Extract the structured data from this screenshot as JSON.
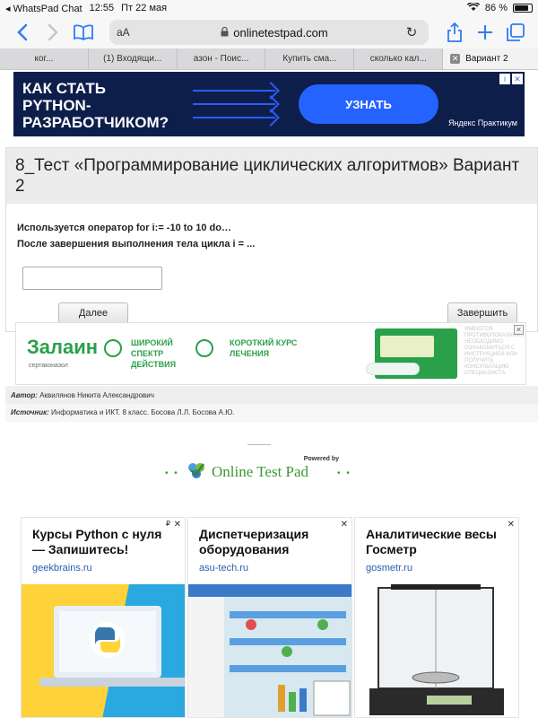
{
  "status": {
    "app_back": "WhatsPad Chat",
    "time": "12:55",
    "date": "Пт 22 мая",
    "battery": "86 %",
    "battery_level": 0.86
  },
  "toolbar": {
    "text_size_label": "аА",
    "url": "onlinetestpad.com"
  },
  "tabs": [
    {
      "label": "ког..."
    },
    {
      "label": "(1) Входящи..."
    },
    {
      "label": "азон - Поис..."
    },
    {
      "label": "Купить сма..."
    },
    {
      "label": "сколько кал..."
    },
    {
      "label": "Вариант 2"
    }
  ],
  "banner": {
    "text_line1": "КАК СТАТЬ",
    "text_line2": "PYTHON-",
    "text_line3": "РАЗРАБОТЧИКОМ?",
    "cta": "УЗНАТЬ",
    "brand": "Яндекс Практикум",
    "colors": {
      "bg": "#0d1e4a",
      "accent": "#2563ff"
    }
  },
  "test": {
    "title": "8_Тест «Программирование циклических алгоритмов» Вариант 2",
    "question_line1": "Используется оператор for i:= -10 to 10 do…",
    "question_line2": "После завершения выполнения тела цикла i = ...",
    "answer_value": "",
    "next_button": "Далее",
    "finish_button": "Завершить"
  },
  "zalain_ad": {
    "logo": "Залаин",
    "subtitle": "сертаконазол",
    "claim1": "ШИРОКИЙ СПЕКТР ДЕЙСТВИЯ",
    "claim2": "КОРОТКИЙ КУРС ЛЕЧЕНИЯ",
    "warning": "ИМЕЮТСЯ ПРОТИВОПОКАЗАНИЯ НЕОБХОДИМО ОЗНАКОМИТЬСЯ С ИНСТРУКЦИЕЙ ИЛИ ПОЛУЧИТЬ КОНСУЛЬТАЦИЮ СПЕЦИАЛИСТА",
    "close": "✕"
  },
  "meta": {
    "author_label": "Автор:",
    "author": "Аквилянов Никита Александрович",
    "source_label": "Источник:",
    "source": "Информатика и ИКТ. 8 класс. Босова Л.Л. Босова А.Ю."
  },
  "footer": {
    "powered_by": "Powered by",
    "brand": "Online Test Pad"
  },
  "ad_cards": [
    {
      "title": "Курсы Python с нуля — Запишитесь!",
      "domain": "geekbrains.ru",
      "close": "✕"
    },
    {
      "title": "Диспетчеризация оборудования",
      "domain": "asu-tech.ru",
      "close": "✕"
    },
    {
      "title": "Аналитические весы Госметр",
      "domain": "gosmetr.ru",
      "close": "✕"
    }
  ]
}
